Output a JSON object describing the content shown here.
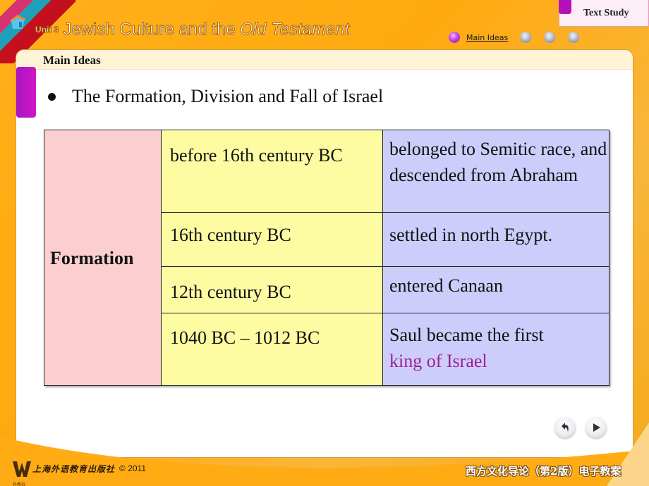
{
  "header": {
    "unit_label": "Unit 3",
    "title_plain": "Jewish Culture and the ",
    "title_italic": "Old Testament",
    "home_icon": "home-icon"
  },
  "tabs": {
    "text_study": "Text Study"
  },
  "nav": {
    "active_label": "Main Ideas",
    "dots": [
      {
        "state": "active",
        "icon": "purple-orb-icon"
      },
      {
        "state": "inactive",
        "icon": "gray-orb-icon"
      },
      {
        "state": "inactive",
        "icon": "gray-orb-icon"
      },
      {
        "state": "inactive",
        "icon": "gray-orb-icon"
      }
    ]
  },
  "panel": {
    "header": "Main Ideas",
    "bullet": "The Formation, Division and Fall of Israel"
  },
  "table": {
    "category": "Formation",
    "rows": [
      {
        "date": "before 16th century BC",
        "desc": "belonged to Semitic race, and descended from Abraham",
        "desc_highlight": ""
      },
      {
        "date": "16th century BC",
        "desc": "settled in north Egypt.",
        "desc_highlight": ""
      },
      {
        "date": "12th century BC",
        "desc": "entered Canaan",
        "desc_highlight": ""
      },
      {
        "date": "1040 BC – 1012 BC",
        "desc": "Saul became the first ",
        "desc_highlight": "king of Israel"
      }
    ],
    "colors": {
      "category_bg": "#fbcfcf",
      "date_bg": "#fdfca2",
      "desc_bg": "#cdcdfb",
      "highlight": "#9b2193"
    }
  },
  "controls": {
    "back_icon": "return-arrow-icon",
    "next_icon": "play-next-icon"
  },
  "footer": {
    "publisher": "上海外语教育出版社",
    "publisher_logo_caption": "外教社",
    "copyright": "© 2011",
    "course": "西方文化导论（第2版）电子教案"
  },
  "theme": {
    "background": "#ffad1a",
    "accent_purple": "#b511b9"
  }
}
